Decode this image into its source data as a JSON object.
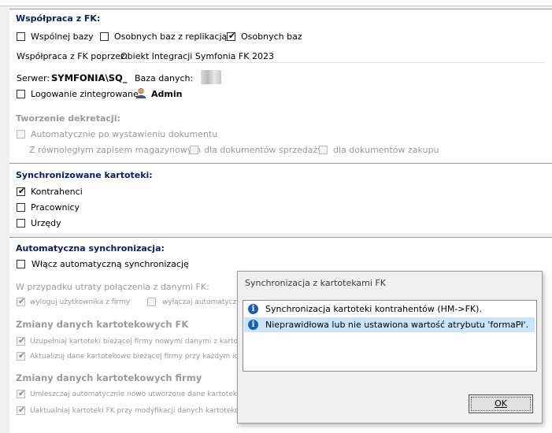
{
  "fk": {
    "title": "Współpraca z FK:",
    "options": [
      "Wspólnej bazy",
      "Osobnych baz z replikacją",
      "Osobnych baz"
    ],
    "via_label": "Współpraca z FK poprzez:",
    "via_value": "Obiekt Integracji Symfonia FK 2023",
    "server_label": "Serwer:",
    "server_value": "SYMFONIA\\SQ_",
    "db_label": "Baza danych:",
    "integrated_login": "Logowanie zintegrowane",
    "user": "Admin"
  },
  "decree": {
    "title": "Tworzenie dekretacji:",
    "auto_label": "Automatycznie po wystawieniu dokumentu",
    "parallel_label": "Z równoległym zapisem magazynowym",
    "sales_label": "dla dokumentów sprzedaży",
    "purchase_label": "dla dokumentów zakupu"
  },
  "sync": {
    "title": "Synchronizowane kartoteki:",
    "items": [
      "Kontrahenci",
      "Pracownicy",
      "Urzędy"
    ]
  },
  "autosync": {
    "title": "Automatyczna synchronizacja:",
    "enable_label": "Włącz automatyczną synchronizację",
    "lost_conn_label": "W przypadku utraty połączenia z danymi FK:",
    "logout_label": "wyloguj użytkownika z firmy",
    "disable_label": "wyłączaj automatyczn",
    "fk_changes_title": "Zmiany danych kartotekowych FK",
    "fk_change_1": "Uzupełniaj kartoteki bieżącej firmy nowymi danymi z kartotek FK",
    "fk_change_2": "Aktualizuj dane kartotekowe bieżącej firmy przy każdym ich wyko",
    "firm_changes_title": "Zmiany danych kartotekowych firmy",
    "firm_change_1": "Umieszczaj automatycznie nowo utworzone dane kartotekowe b",
    "firm_change_2": "Uaktualniaj kartoteki FK przy modyfikacji danych kartotekowych"
  },
  "dialog": {
    "title": "Synchronizacja z kartotekami FK",
    "messages": [
      "Synchronizacja kartoteki kontrahentów (HM->FK).",
      "Nieprawidłowa lub nie ustawiona wartość atrybutu 'formaPł'."
    ],
    "ok_label": "OK"
  },
  "icons": {
    "info": "info-icon",
    "user": "user-icon",
    "check": "checkmark-icon"
  },
  "colors": {
    "section_title": "#0a1a6e",
    "selection": "#cce4f7",
    "info_icon": "#1a5fb4"
  }
}
